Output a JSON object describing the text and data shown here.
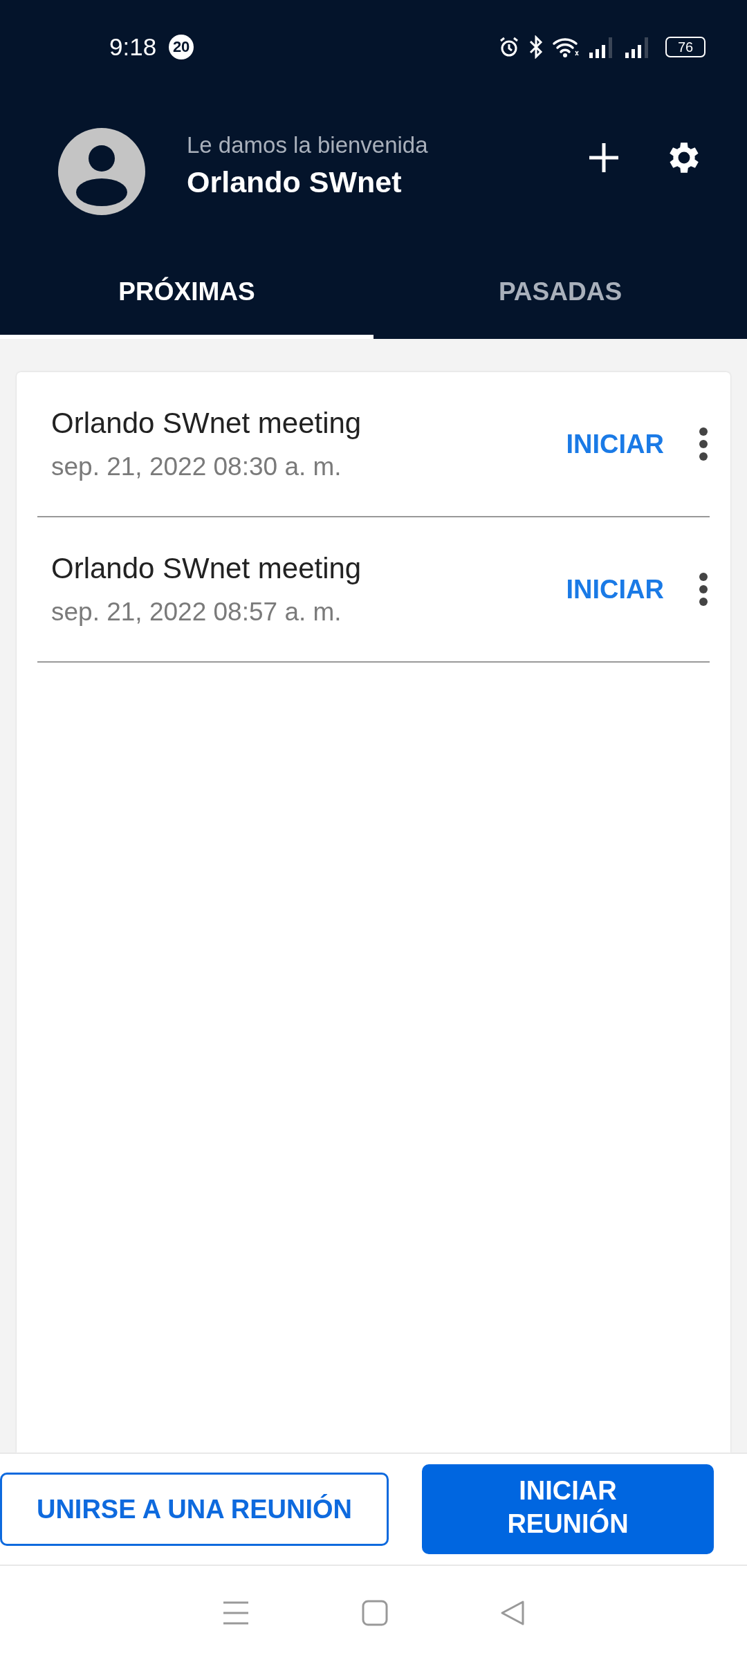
{
  "status_bar": {
    "time": "9:18",
    "notification_count": "20",
    "battery": "76"
  },
  "header": {
    "greeting": "Le damos la bienvenida",
    "user_name": "Orlando SWnet"
  },
  "tabs": [
    {
      "label": "PRÓXIMAS",
      "selected": true
    },
    {
      "label": "PASADAS",
      "selected": false
    }
  ],
  "meetings": [
    {
      "title": "Orlando SWnet meeting",
      "datetime": "sep. 21, 2022 08:30 a. m.",
      "action": "INICIAR"
    },
    {
      "title": "Orlando SWnet meeting",
      "datetime": "sep. 21, 2022 08:57 a. m.",
      "action": "INICIAR"
    }
  ],
  "buttons": {
    "join": "UNIRSE A UNA REUNIÓN",
    "start": "INICIAR REUNIÓN"
  }
}
